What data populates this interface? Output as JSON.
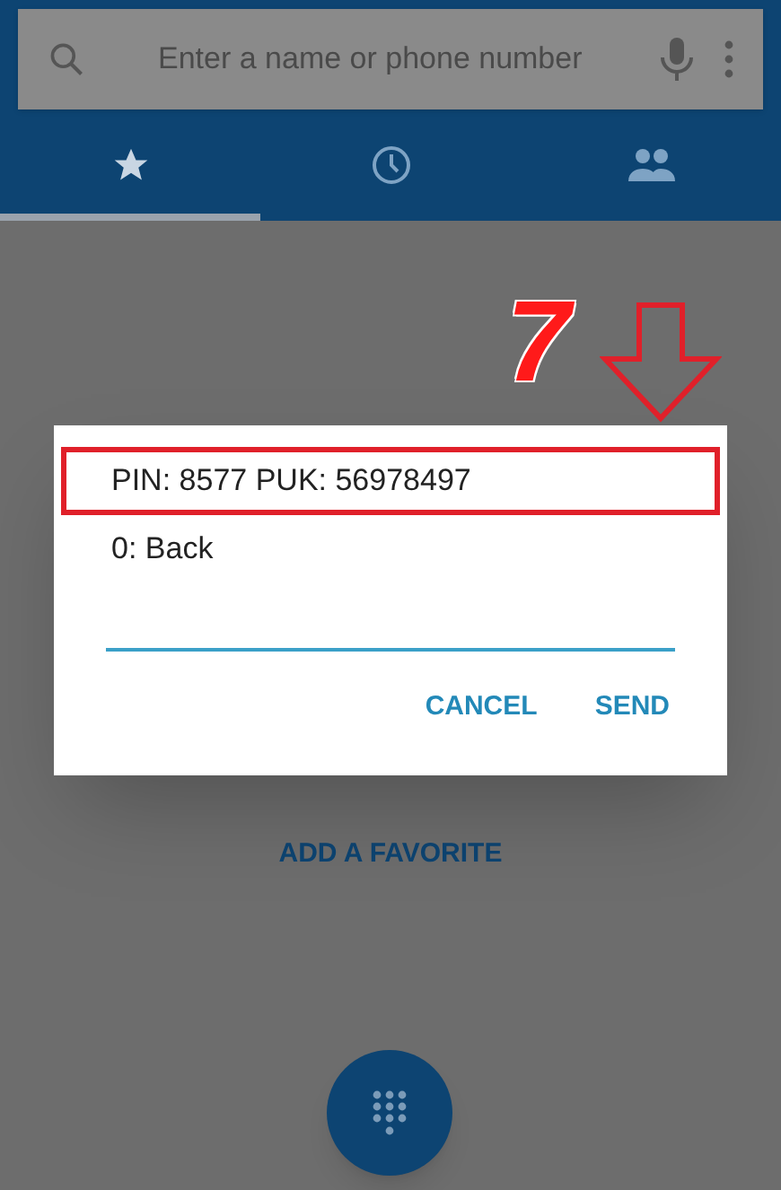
{
  "search": {
    "placeholder": "Enter a name or phone number"
  },
  "tabs": [
    {
      "kind": "star",
      "selected": true
    },
    {
      "kind": "clock",
      "selected": false
    },
    {
      "kind": "people",
      "selected": false
    }
  ],
  "add_favorite": "ADD A FAVORITE",
  "dialog": {
    "lines": [
      {
        "text": "PIN: 8577 PUK: 56978497",
        "highlighted": true
      },
      {
        "text": "0: Back",
        "highlighted": false
      }
    ],
    "buttons": [
      "CANCEL",
      "SEND"
    ]
  },
  "annotation": {
    "step": "7"
  }
}
